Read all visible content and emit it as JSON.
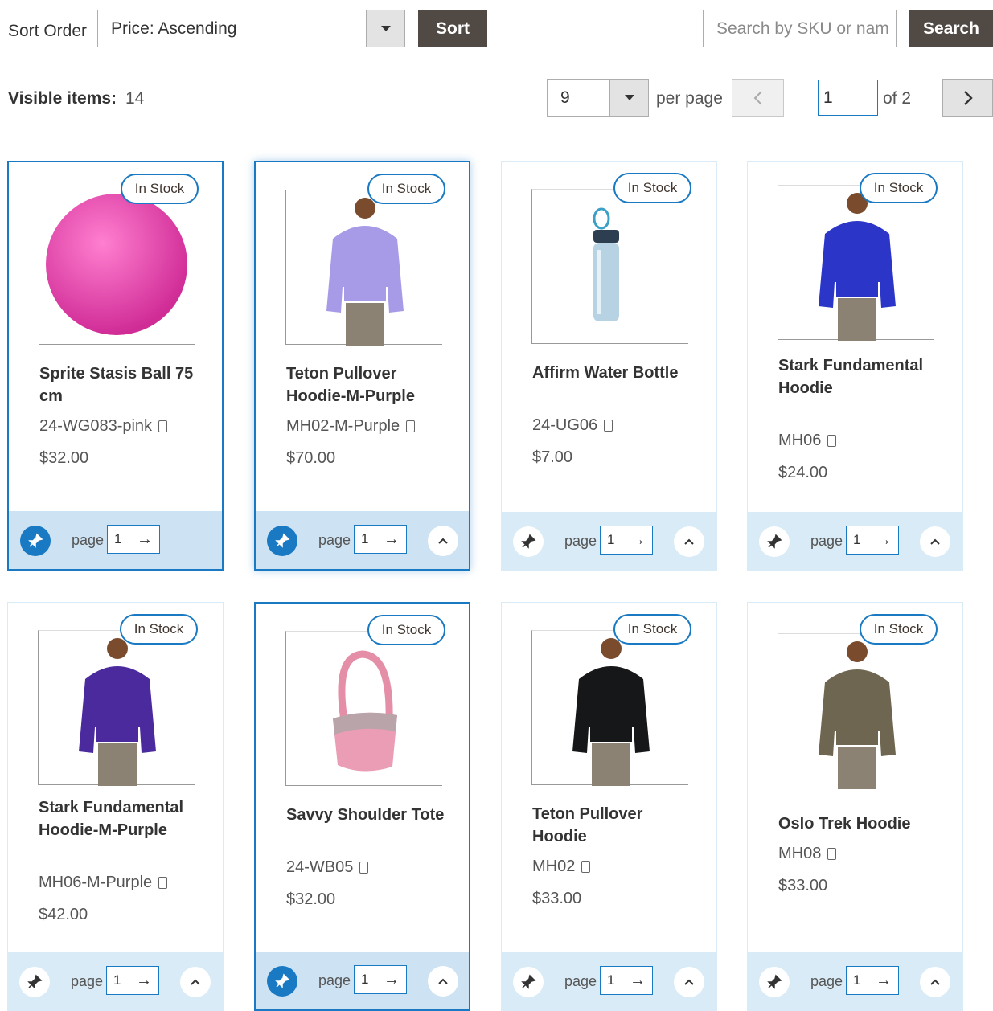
{
  "toolbar": {
    "sort_label": "Sort Order",
    "sort_value": "Price: Ascending",
    "sort_button": "Sort",
    "search_placeholder": "Search by SKU or nam",
    "search_button": "Search",
    "visible_label": "Visible items:",
    "visible_count": "14",
    "per_page_value": "9",
    "per_page_label": "per page",
    "page_value": "1",
    "page_of": "of 2"
  },
  "products": [
    {
      "badge": "In Stock",
      "name": "Sprite Stasis Ball 75 cm",
      "sku": "24-WG083-pink",
      "price": "$32.00",
      "page_label": "page",
      "page_value": "1",
      "image": "pink-ball-image",
      "pinned": true,
      "has_up": false
    },
    {
      "badge": "In Stock",
      "name": "Teton Pullover Hoodie-M-Purple",
      "sku": "MH02-M-Purple",
      "price": "$70.00",
      "page_label": "page",
      "page_value": "1",
      "image": "purple-hoodie-image",
      "pinned": true,
      "has_up": true
    },
    {
      "badge": "In Stock",
      "name": "Affirm Water Bottle",
      "sku": "24-UG06",
      "price": "$7.00",
      "page_label": "page",
      "page_value": "1",
      "image": "water-bottle-image",
      "pinned": false,
      "has_up": true
    },
    {
      "badge": "In Stock",
      "name": "Stark Fundamental Hoodie",
      "sku": "MH06",
      "price": "$24.00",
      "page_label": "page",
      "page_value": "1",
      "image": "blue-hoodie-image",
      "pinned": false,
      "has_up": true
    },
    {
      "badge": "In Stock",
      "name": "Stark Fundamental Hoodie-M-Purple",
      "sku": "MH06-M-Purple",
      "price": "$42.00",
      "page_label": "page",
      "page_value": "1",
      "image": "violet-hoodie-image",
      "pinned": false,
      "has_up": true
    },
    {
      "badge": "In Stock",
      "name": "Savvy Shoulder Tote",
      "sku": "24-WB05",
      "price": "$32.00",
      "page_label": "page",
      "page_value": "1",
      "image": "pink-tote-image",
      "pinned": true,
      "has_up": true
    },
    {
      "badge": "In Stock",
      "name": "Teton Pullover Hoodie",
      "sku": "MH02",
      "price": "$33.00",
      "page_label": "page",
      "page_value": "1",
      "image": "black-hoodie-image",
      "pinned": false,
      "has_up": true
    },
    {
      "badge": "In Stock",
      "name": "Oslo Trek Hoodie",
      "sku": "MH08",
      "price": "$33.00",
      "page_label": "page",
      "page_value": "1",
      "image": "olive-hoodie-image",
      "pinned": false,
      "has_up": true
    }
  ],
  "colors": {
    "accent": "#1979c3",
    "dark_button": "#514943",
    "footer_bg": "#d8ebf6"
  }
}
